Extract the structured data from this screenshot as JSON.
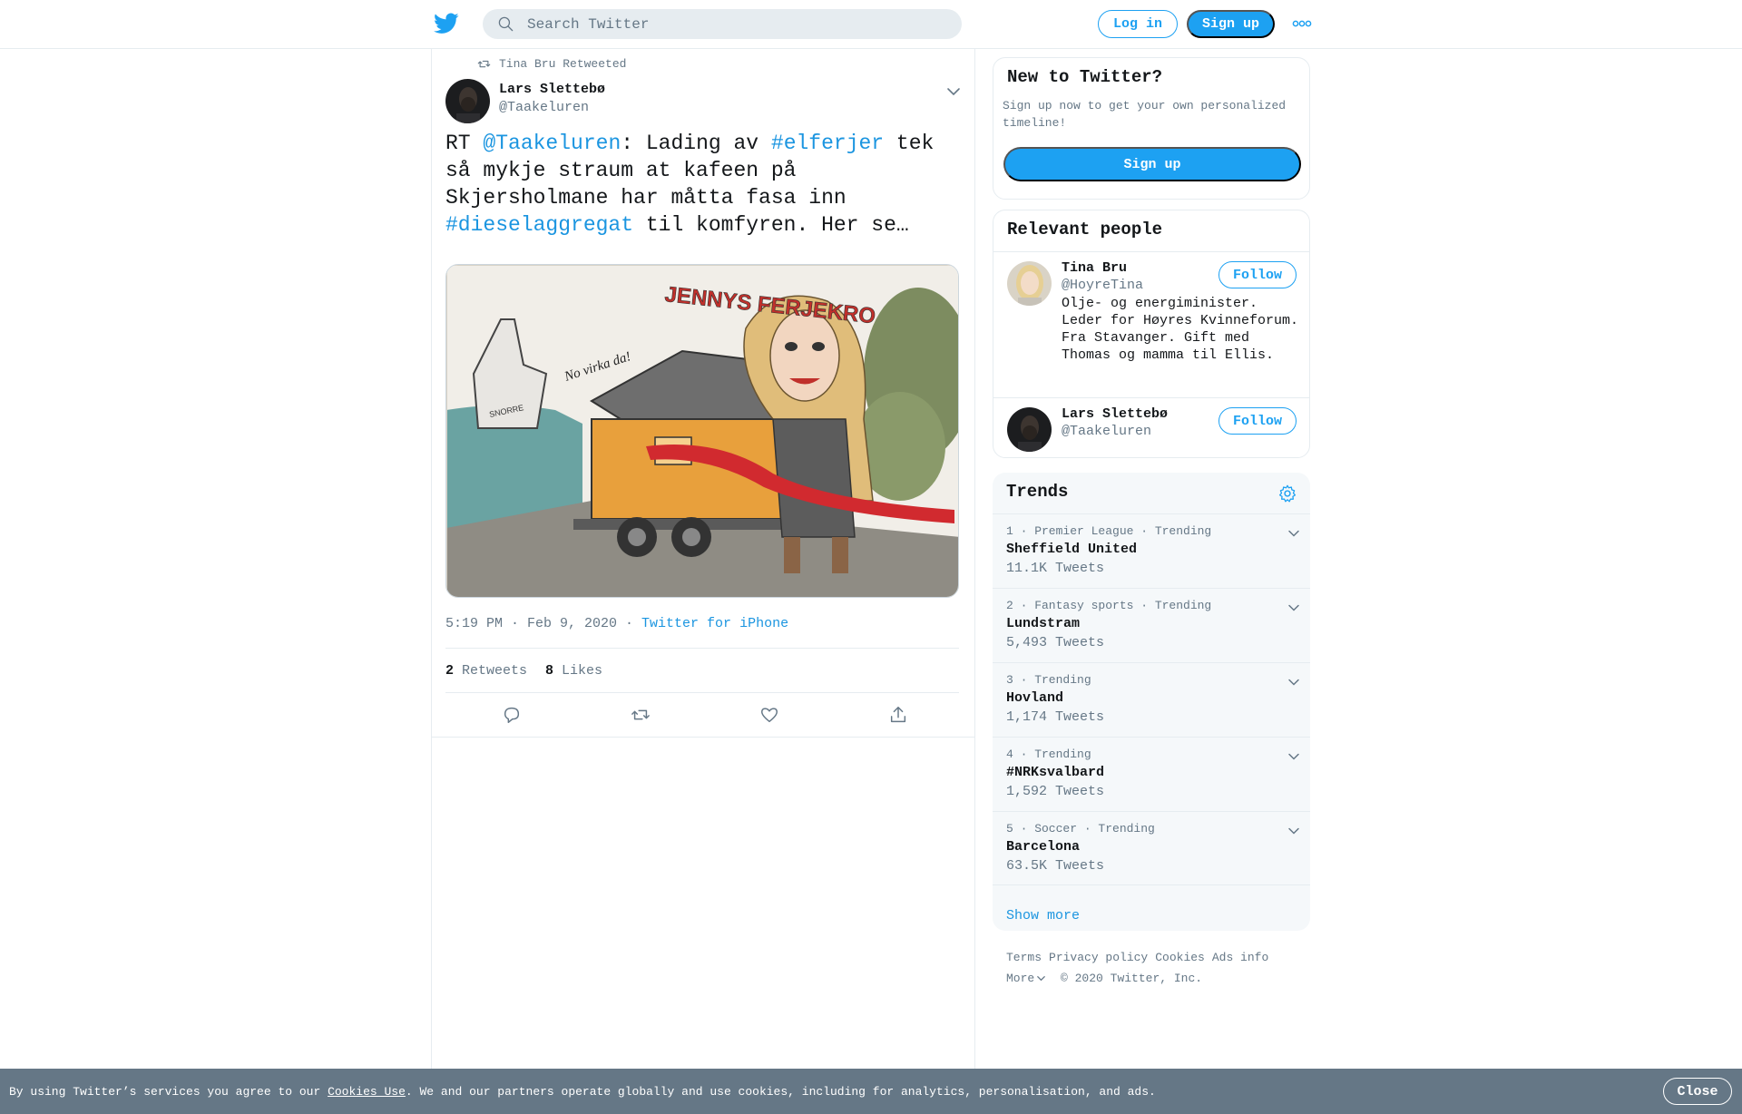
{
  "header": {
    "search_placeholder": "Search Twitter",
    "login_label": "Log in",
    "signup_label": "Sign up",
    "logo_icon": "twitter-bird-icon",
    "more_icon": "more-dots-icon"
  },
  "tweet": {
    "retweeted_by": "Tina Bru Retweeted",
    "author_name": "Lars Slettebø",
    "author_handle": "@Taakeluren",
    "text_parts": {
      "p1": "RT ",
      "mention": "@Taakeluren",
      "p2": ": Lading av ",
      "hashtag1": "#elferjer",
      "p3": " tek så mykje straum at kafeen på Skjersholmane har måtta fasa inn ",
      "hashtag2": "#dieselaggregat",
      "p4": " til komfyren.  Her se…"
    },
    "image_text": {
      "sign": "JENNYS FERJEKRO",
      "speech": "No virka da!",
      "ship": "SNORRE"
    },
    "time": "5:19 PM · Feb 9, 2020",
    "separator": " · ",
    "source": "Twitter for iPhone",
    "retweets_count": "2",
    "retweets_label": "Retweets",
    "likes_count": "8",
    "likes_label": "Likes"
  },
  "sidebar": {
    "new_to_twitter": {
      "title": "New to Twitter?",
      "description": "Sign up now to get your own personalized timeline!",
      "button": "Sign up"
    },
    "relevant_people": {
      "title": "Relevant people",
      "people": [
        {
          "name": "Tina Bru",
          "handle": "@HoyreTina",
          "bio": "Olje- og energiminister. Leder for Høyres Kvinneforum. Fra Stavanger. Gift med Thomas og mamma til Ellis.",
          "follow": "Follow"
        },
        {
          "name": "Lars Slettebø",
          "handle": "@Taakeluren",
          "follow": "Follow"
        }
      ]
    },
    "trends": {
      "title": "Trends",
      "items": [
        {
          "context": "1 · Premier League · Trending",
          "topic": "Sheffield United",
          "count": "11.1K Tweets"
        },
        {
          "context": "2 · Fantasy sports · Trending",
          "topic": "Lundstram",
          "count": "5,493 Tweets"
        },
        {
          "context": "3 · Trending",
          "topic": "Hovland",
          "count": "1,174 Tweets"
        },
        {
          "context": "4 · Trending",
          "topic": "#NRKsvalbard",
          "count": "1,592 Tweets"
        },
        {
          "context": "5 · Soccer · Trending",
          "topic": "Barcelona",
          "count": "63.5K Tweets"
        }
      ],
      "show_more": "Show more"
    },
    "footer": {
      "links": [
        "Terms",
        "Privacy policy",
        "Cookies",
        "Ads info"
      ],
      "more": "More",
      "copyright": "© 2020 Twitter, Inc."
    }
  },
  "cookie_bar": {
    "text_before": "By using Twitter’s services you agree to our ",
    "link": "Cookies Use",
    "text_after": ". We and our partners operate globally and use cookies, including for analytics, personalisation, and ads.",
    "close": "Close"
  },
  "colors": {
    "accent": "#1da1f2",
    "link": "#1b95e0",
    "secondary_text": "#657786",
    "border": "#e6ecf0",
    "cookie_bg": "#657786"
  }
}
